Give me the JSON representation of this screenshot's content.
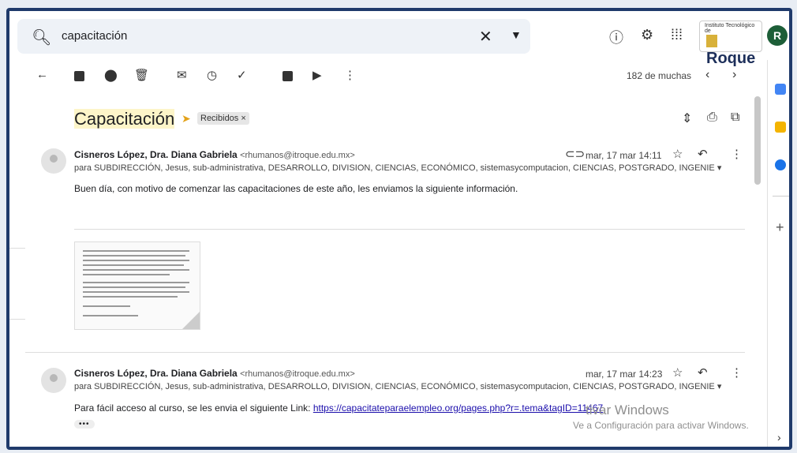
{
  "search": {
    "query": "capacitación"
  },
  "logo": {
    "small_text": "Instituto Tecnológico de",
    "big_text": "Roque"
  },
  "avatar": {
    "letter": "R",
    "color": "#1d5e38"
  },
  "toolbar": {
    "count": "182 de muchas"
  },
  "thread": {
    "subject": "Capacitación",
    "label": "Recibidos ×"
  },
  "messages": [
    {
      "sender": "Cisneros López, Dra. Diana Gabriela",
      "email": "<rhumanos@itroque.edu.mx>",
      "recipients": "para SUBDIRECCIÓN, Jesus, sub-administrativa, DESARROLLO, DIVISION, CIENCIAS, ECONÓMICO, sistemasycomputacion, CIENCIAS, POSTGRADO, INGENIE",
      "date": "mar, 17 mar 14:11",
      "body": "Buen día, con motivo de comenzar las capacitaciones de este año, les enviamos la siguiente información."
    },
    {
      "sender": "Cisneros López, Dra. Diana Gabriela",
      "email": "<rhumanos@itroque.edu.mx>",
      "recipients": "para SUBDIRECCIÓN, Jesus, sub-administrativa, DESARROLLO, DIVISION, CIENCIAS, ECONÓMICO, sistemasycomputacion, CIENCIAS, POSTGRADO, INGENIE",
      "date": "mar, 17 mar 14:23",
      "body_prefix": "Para fácil acceso al curso, se les envia el siguiente Link:",
      "link": "https://capacitateparaelempleo.org/pages.php?r=.tema&tagID=11467"
    }
  ],
  "watermark": {
    "line1": "tivar Windows",
    "line2": "Ve a Configuración para activar Windows."
  },
  "colors": {
    "frame": "#1f3a6b",
    "important": "#e3a21a",
    "link": "#1a0dab"
  }
}
